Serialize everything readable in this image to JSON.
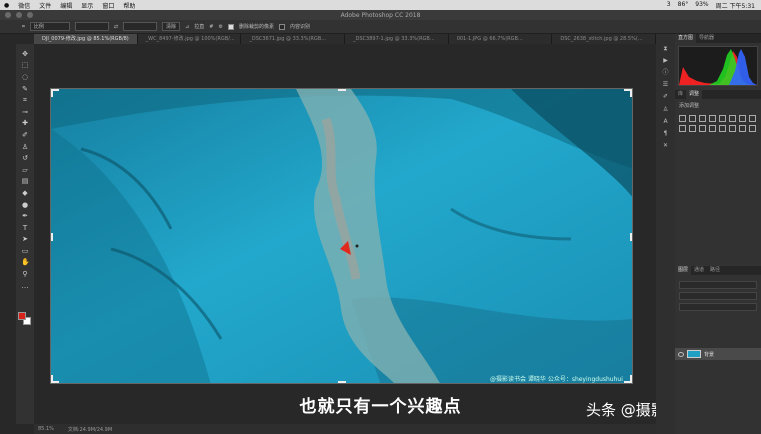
{
  "menubar": {
    "items": [
      "微信",
      "文件",
      "编辑",
      "显示",
      "窗口",
      "帮助"
    ],
    "status": [
      "3",
      "86°",
      "93%",
      "周二 下午5:31"
    ]
  },
  "window": {
    "title": "Adobe Photoshop CC 2018"
  },
  "options": {
    "ratio_select": "比例",
    "clear_button": "清除",
    "straighten_label": "拉直",
    "delete_cropped_label": "删除裁剪的像素",
    "content_aware_label": "内容识别"
  },
  "tabs": [
    "DJI_0079-修改.jpg @ 85.1%(RGB/8)",
    "_WC_8497-修改.jpg @ 100%(RGB/...",
    "_DSC3671.jpg @ 33.3%(RGB...",
    "_DSC3897-1.jpg @ 33.3%(RGB...",
    "001-1.JPG @ 66.7%(RGB...",
    "DSC_2638_stitch.jpg @ 28.5%(..."
  ],
  "image": {
    "watermark": "@摄影读书会  谭晓华  公众号：sheyingdushuhui"
  },
  "subtitle": "也就只有一个兴趣点",
  "brand": "头条 @摄影读书会",
  "status": {
    "zoom": "85.1%",
    "doc": "文档:24.9M/24.9M"
  },
  "panels": {
    "top_tabs": [
      "直方图",
      "导航器"
    ],
    "adjust_tabs": [
      "库",
      "调整"
    ],
    "adjust_title": "添加调整",
    "layers_tabs": [
      "图层",
      "通道",
      "路径"
    ],
    "layer_name": "背景"
  },
  "colors": {
    "water": "#1f9fc4",
    "foreground": "#d8231d",
    "background": "#ffffff"
  }
}
